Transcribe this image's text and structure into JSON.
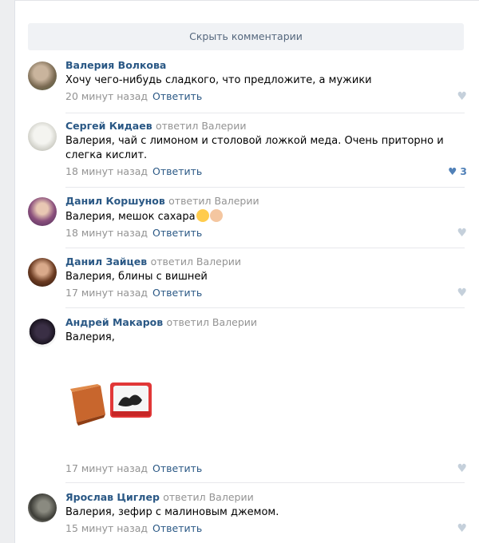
{
  "hide_comments": "Скрыть комментарии",
  "reply_label": "Ответить",
  "replied_to": "ответил Валерии",
  "comments": [
    {
      "author": "Валерия Волкова",
      "text": "Хочу чего-нибудь сладкого, что предложите, а мужики",
      "time": "20 минут назад",
      "likes": ""
    },
    {
      "author": "Сергей Кидаев",
      "text": "Валерия, чай с лимоном и столовой ложкой меда. Очень приторно и слегка кислит.",
      "time": "18 минут назад",
      "likes": "3"
    },
    {
      "author": "Данил Коршунов",
      "text": "Валерия, мешок сахара",
      "time": "18 минут назад",
      "likes": ""
    },
    {
      "author": "Данил Зайцев",
      "text": "Валерия, блины с вишней",
      "time": "17 минут назад",
      "likes": ""
    },
    {
      "author": "Андрей Макаров",
      "text": "Валерия,",
      "time": "17 минут назад",
      "likes": ""
    },
    {
      "author": "Ярослав Циглер",
      "text": "Валерия, зефир с малиновым джемом.",
      "time": "15 минут назад",
      "likes": ""
    }
  ],
  "colors": {
    "link": "#2a5885",
    "muted": "#939393",
    "like_active": "#5181b8",
    "like_inactive": "#c5d0db"
  },
  "icons": {
    "like": "heart-icon"
  }
}
